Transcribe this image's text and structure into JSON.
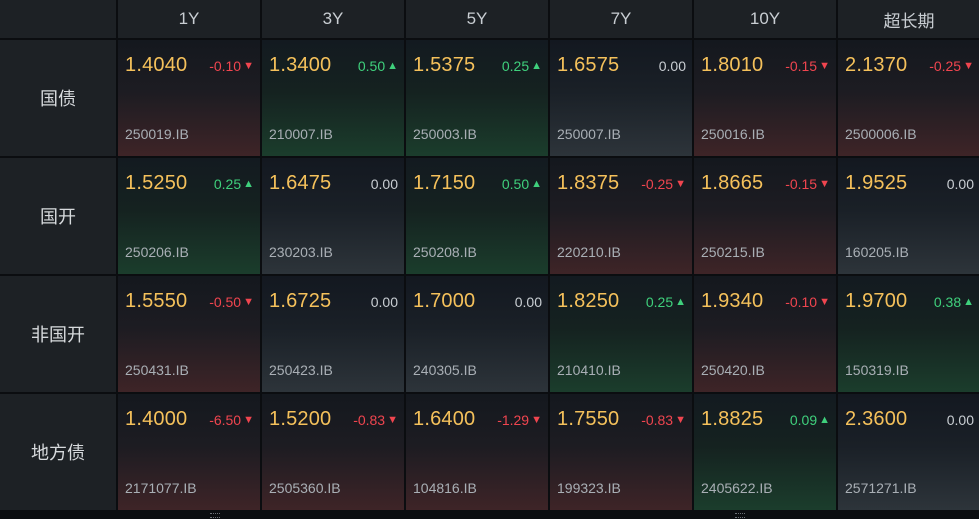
{
  "columns": [
    "1Y",
    "3Y",
    "5Y",
    "7Y",
    "10Y",
    "超长期"
  ],
  "rows": [
    {
      "label": "国债",
      "cells": [
        {
          "yield": "1.4040",
          "change": "-0.10",
          "dir": "down",
          "code": "250019.IB"
        },
        {
          "yield": "1.3400",
          "change": "0.50",
          "dir": "up",
          "code": "210007.IB"
        },
        {
          "yield": "1.5375",
          "change": "0.25",
          "dir": "up",
          "code": "250003.IB"
        },
        {
          "yield": "1.6575",
          "change": "0.00",
          "dir": "flat",
          "code": "250007.IB"
        },
        {
          "yield": "1.8010",
          "change": "-0.15",
          "dir": "down",
          "code": "250016.IB"
        },
        {
          "yield": "2.1370",
          "change": "-0.25",
          "dir": "down",
          "code": "2500006.IB"
        }
      ]
    },
    {
      "label": "国开",
      "cells": [
        {
          "yield": "1.5250",
          "change": "0.25",
          "dir": "up",
          "code": "250206.IB"
        },
        {
          "yield": "1.6475",
          "change": "0.00",
          "dir": "flat",
          "code": "230203.IB"
        },
        {
          "yield": "1.7150",
          "change": "0.50",
          "dir": "up",
          "code": "250208.IB"
        },
        {
          "yield": "1.8375",
          "change": "-0.25",
          "dir": "down",
          "code": "220210.IB"
        },
        {
          "yield": "1.8665",
          "change": "-0.15",
          "dir": "down",
          "code": "250215.IB"
        },
        {
          "yield": "1.9525",
          "change": "0.00",
          "dir": "flat",
          "code": "160205.IB"
        }
      ]
    },
    {
      "label": "非国开",
      "cells": [
        {
          "yield": "1.5550",
          "change": "-0.50",
          "dir": "down",
          "code": "250431.IB"
        },
        {
          "yield": "1.6725",
          "change": "0.00",
          "dir": "flat",
          "code": "250423.IB"
        },
        {
          "yield": "1.7000",
          "change": "0.00",
          "dir": "flat",
          "code": "240305.IB"
        },
        {
          "yield": "1.8250",
          "change": "0.25",
          "dir": "up",
          "code": "210410.IB"
        },
        {
          "yield": "1.9340",
          "change": "-0.10",
          "dir": "down",
          "code": "250420.IB"
        },
        {
          "yield": "1.9700",
          "change": "0.38",
          "dir": "up",
          "code": "150319.IB"
        }
      ]
    },
    {
      "label": "地方债",
      "cells": [
        {
          "yield": "1.4000",
          "change": "-6.50",
          "dir": "down",
          "code": "2171077.IB"
        },
        {
          "yield": "1.5200",
          "change": "-0.83",
          "dir": "down",
          "code": "2505360.IB"
        },
        {
          "yield": "1.6400",
          "change": "-1.29",
          "dir": "down",
          "code": "104816.IB"
        },
        {
          "yield": "1.7550",
          "change": "-0.83",
          "dir": "down",
          "code": "199323.IB"
        },
        {
          "yield": "1.8825",
          "change": "0.09",
          "dir": "up",
          "code": "2405622.IB"
        },
        {
          "yield": "2.3600",
          "change": "0.00",
          "dir": "flat",
          "code": "2571271.IB"
        }
      ]
    }
  ],
  "arrows": {
    "up": "▲",
    "down": "▼",
    "flat": ""
  },
  "colors": {
    "up": "#3fd07c",
    "down": "#f0454f",
    "yield": "#f5c15b",
    "flat": "#c9ced3"
  }
}
